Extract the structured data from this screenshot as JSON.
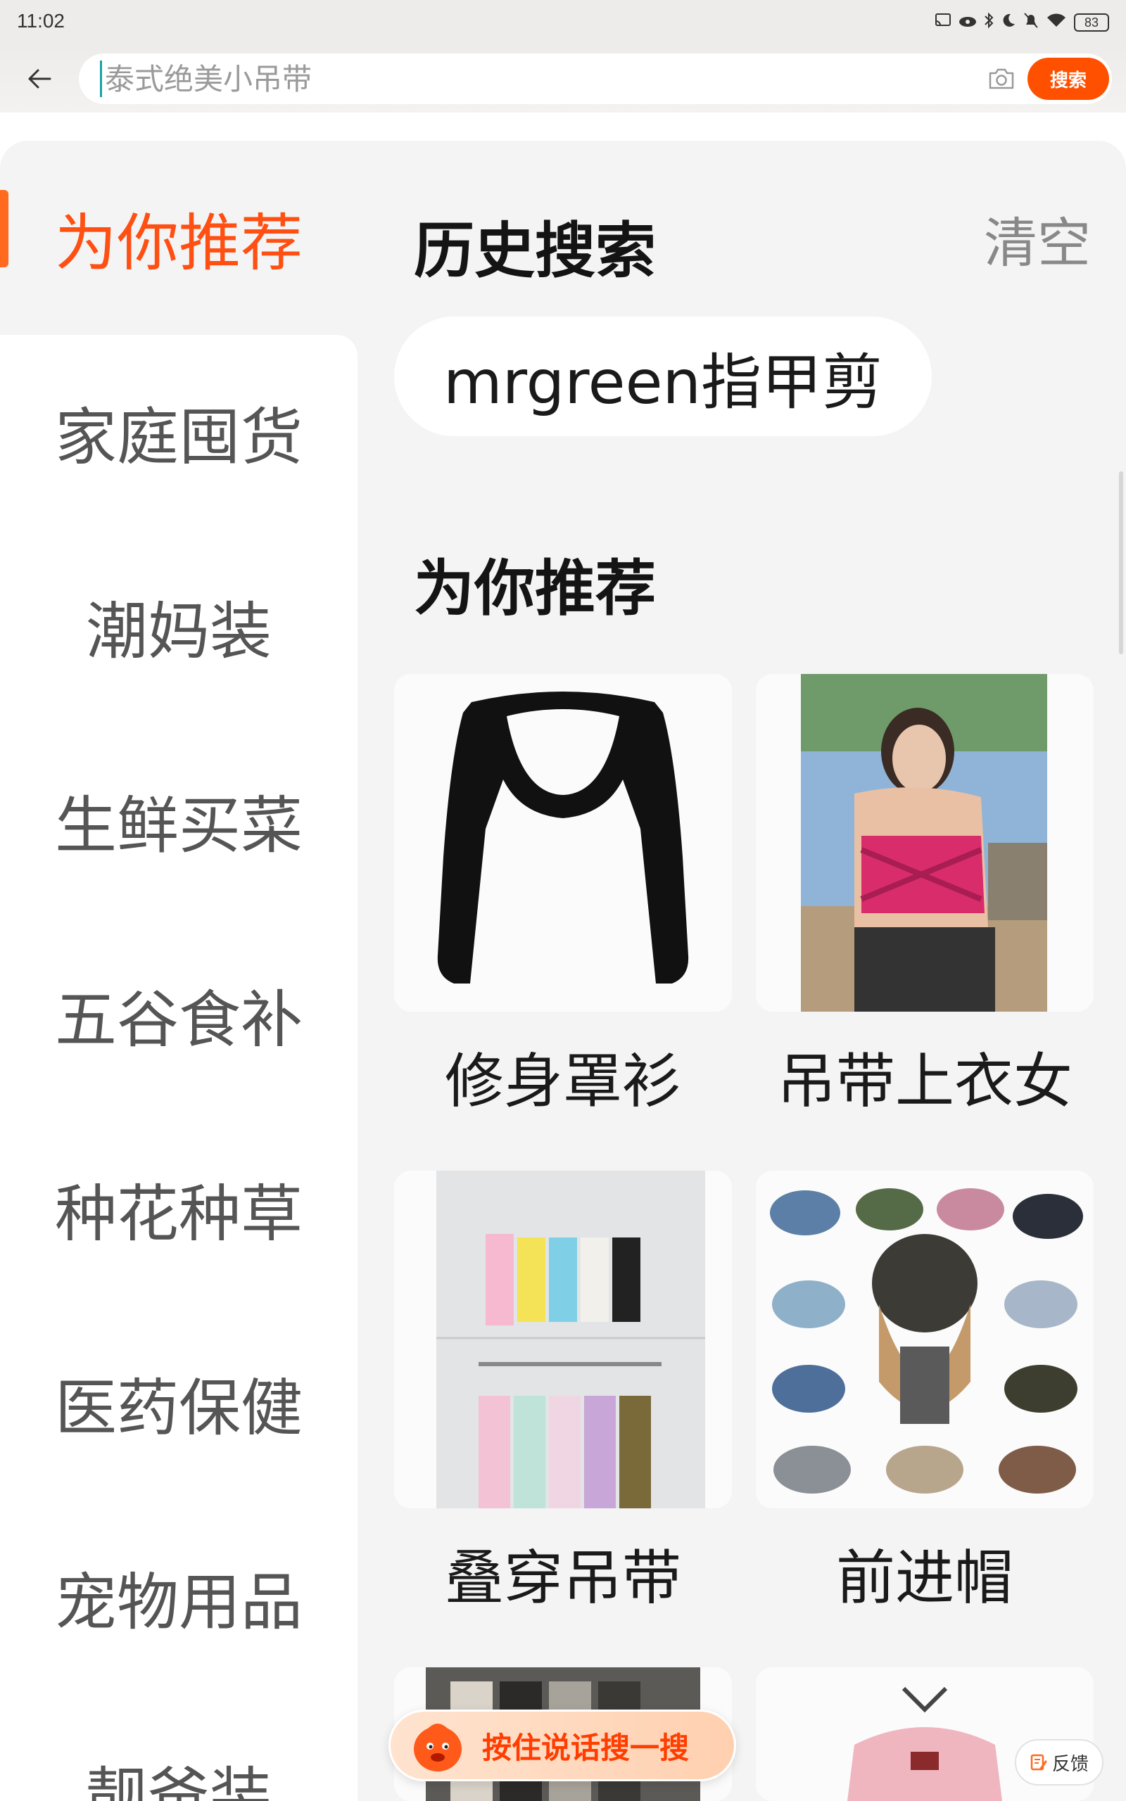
{
  "status_bar": {
    "time": "11:02",
    "battery": "83",
    "icons": [
      "cast-icon",
      "eye-icon",
      "bluetooth-icon",
      "moon-icon",
      "bell-off-icon",
      "wifi-icon",
      "battery-icon"
    ]
  },
  "search": {
    "placeholder": "泰式绝美小吊带",
    "button_label": "搜索"
  },
  "sidebar": {
    "items": [
      {
        "label": "为你推荐",
        "active": true
      },
      {
        "label": "家庭囤货"
      },
      {
        "label": "潮妈装"
      },
      {
        "label": "生鲜买菜"
      },
      {
        "label": "五谷食补"
      },
      {
        "label": "种花种草"
      },
      {
        "label": "医药保健"
      },
      {
        "label": "宠物用品"
      },
      {
        "label": "靓爸装"
      }
    ]
  },
  "history": {
    "title": "历史搜索",
    "clear_label": "清空",
    "chips": [
      "mrgreen指甲剪"
    ]
  },
  "recommend": {
    "title": "为你推荐",
    "cards": [
      {
        "label": "修身罩衫",
        "image": "black-shrug-top"
      },
      {
        "label": "吊带上衣女",
        "image": "woman-pink-camisole"
      },
      {
        "label": "叠穿吊带",
        "image": "camisoles-on-rack"
      },
      {
        "label": "前进帽",
        "image": "newsboy-caps-grid"
      },
      {
        "label": "",
        "image": "clothes-rack"
      },
      {
        "label": "",
        "image": "pink-halter-top"
      }
    ]
  },
  "voice": {
    "label": "按住说话搜一搜"
  },
  "feedback": {
    "label": "反馈"
  },
  "colors": {
    "accent": "#ff5000",
    "active_tab": "#ff4f12",
    "panel_bg": "#f4f4f4"
  }
}
